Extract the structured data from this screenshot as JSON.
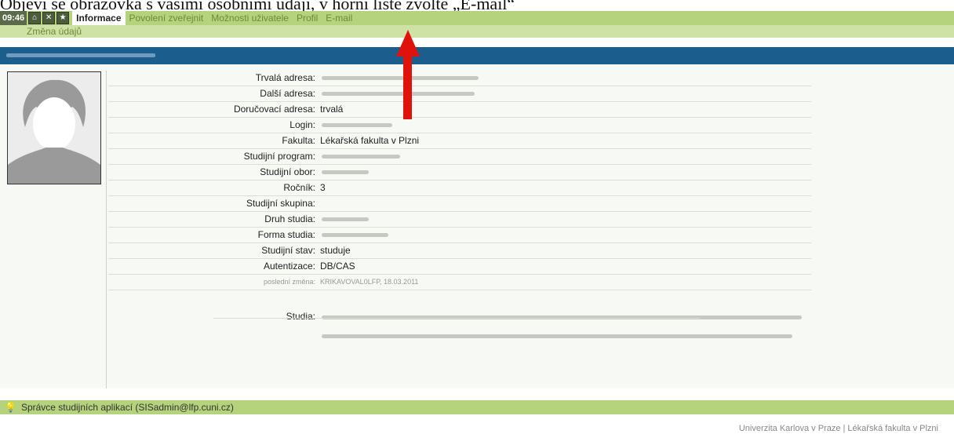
{
  "caption": "Objeví se obrazovka s vašimi osobními údaji, v horní liště zvolte „E-mail“",
  "topbar": {
    "clock": "09:46",
    "icons": [
      "home-icon",
      "logout-icon",
      "favorite-icon"
    ],
    "tabs": [
      {
        "label": "Informace",
        "active": true
      },
      {
        "label": "Povolení zveřejnit",
        "active": false
      },
      {
        "label": "Možnosti uživatele",
        "active": false
      },
      {
        "label": "Profil",
        "active": false
      },
      {
        "label": "E-mail",
        "active": false
      }
    ]
  },
  "subbar": {
    "link": "Změna údajů"
  },
  "fields": [
    {
      "label": "Trvalá adresa:",
      "value": ""
    },
    {
      "label": "Další adresa:",
      "value": ""
    },
    {
      "label": "Doručovací adresa:",
      "value": "trvalá"
    },
    {
      "label": "Login:",
      "value": ""
    },
    {
      "label": "Fakulta:",
      "value": "Lékařská fakulta v Plzni"
    },
    {
      "label": "Studijní program:",
      "value": ""
    },
    {
      "label": "Studijní obor:",
      "value": ""
    },
    {
      "label": "Ročník:",
      "value": "3"
    },
    {
      "label": "Studijní skupina:",
      "value": ""
    },
    {
      "label": "Druh studia:",
      "value": ""
    },
    {
      "label": "Forma studia:",
      "value": ""
    },
    {
      "label": "Studijní stav:",
      "value": "studuje"
    },
    {
      "label": "Autentizace:",
      "value": "DB/CAS"
    },
    {
      "label": "poslední změna:",
      "value": "KRIKAVOVAL0LFP, 18.03.2011"
    }
  ],
  "studia": {
    "label": "Studia:"
  },
  "footer": {
    "admin": "Správce studijních aplikací (SISadmin@lfp.cuni.cz)",
    "copyright": "Univerzita Karlova v Praze | Lékařská fakulta v Plzni"
  },
  "colors": {
    "accent_green": "#b5d27c",
    "header_blue": "#1b5e8e",
    "arrow_red": "#e0120c"
  }
}
